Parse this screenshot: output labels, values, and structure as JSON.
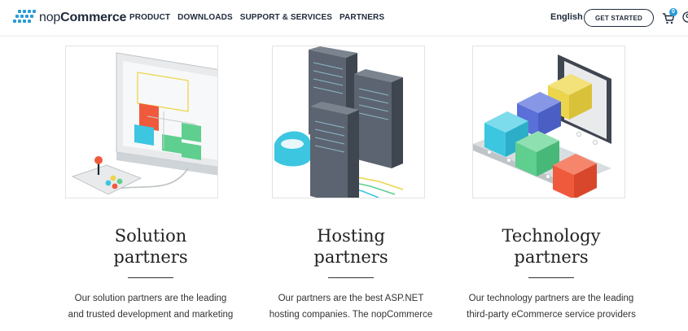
{
  "header": {
    "logo_light": "nop",
    "logo_bold": "Commerce",
    "nav": [
      "PRODUCT",
      "DOWNLOADS",
      "SUPPORT & SERVICES",
      "PARTNERS"
    ],
    "language": "English",
    "cta": "GET STARTED",
    "cart_count": "0",
    "icons": [
      "nopcommerce-logo-icon",
      "cart-icon",
      "account-icon"
    ]
  },
  "cards": [
    {
      "title_line1": "Solution",
      "title_line2": "partners",
      "desc_line1": "Our solution partners are the leading",
      "desc_line2": "and trusted development and marketing",
      "illustration": "monitor-design-illustration"
    },
    {
      "title_line1": "Hosting",
      "title_line2": "partners",
      "desc_line1": "Our partners are the best ASP.NET",
      "desc_line2": "hosting companies. The nopCommerce",
      "illustration": "server-racks-illustration"
    },
    {
      "title_line1": "Technology",
      "title_line2": "partners",
      "desc_line1": "Our technology partners are the leading",
      "desc_line2": "third-party eCommerce service providers",
      "illustration": "conveyor-boxes-illustration"
    }
  ],
  "colors": {
    "brand_blue": "#2a9bd8",
    "text_dark": "#1e2a3a",
    "accent_red": "#f05a3c",
    "accent_green": "#5ecf8e",
    "accent_cyan": "#3cc6e0",
    "accent_yellow": "#ecd54a",
    "accent_indigo": "#5a6fd8"
  }
}
